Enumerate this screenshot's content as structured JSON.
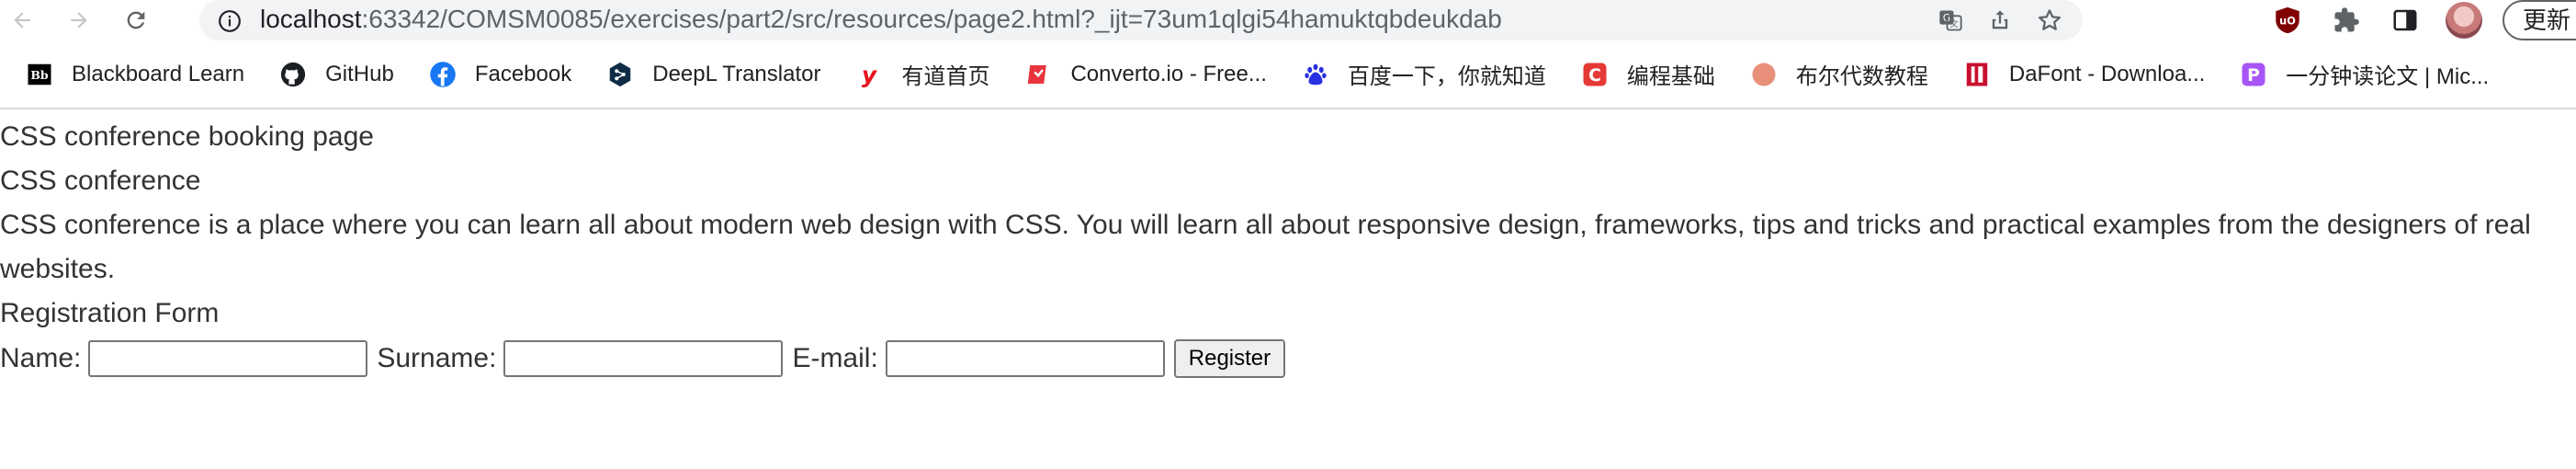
{
  "browser": {
    "url_host": "localhost",
    "url_rest": ":63342/COMSM0085/exercises/part2/src/resources/page2.html?_ijt=73um1qlgi54hamuktqbdeukdab",
    "update_label": "更新",
    "bookmarks": [
      {
        "label": "Blackboard Learn",
        "icon": "blackboard-icon",
        "color": "#000000"
      },
      {
        "label": "GitHub",
        "icon": "github-icon",
        "color": "#1b1f23"
      },
      {
        "label": "Facebook",
        "icon": "facebook-icon",
        "color": "#1877f2"
      },
      {
        "label": "DeepL Translator",
        "icon": "deepl-icon",
        "color": "#0f2b46"
      },
      {
        "label": "有道首页",
        "icon": "youdao-icon",
        "color": "#e8131e"
      },
      {
        "label": "Converto.io - Free...",
        "icon": "converto-icon",
        "color": "#e8343c"
      },
      {
        "label": "百度一下，你就知道",
        "icon": "baidu-icon",
        "color": "#2932e1"
      },
      {
        "label": "编程基础",
        "icon": "c-icon",
        "color": "#e53935"
      },
      {
        "label": "布尔代数教程",
        "icon": "circle-icon",
        "color": "#e8907a"
      },
      {
        "label": "DaFont - Downloa...",
        "icon": "dafont-icon",
        "color": "#c8102e"
      },
      {
        "label": "一分钟读论文 | Mic...",
        "icon": "p-icon",
        "color": "#a855f7"
      }
    ]
  },
  "page": {
    "title": "CSS conference booking page",
    "heading": "CSS conference",
    "description": "CSS conference is a place where you can learn all about modern web design with CSS. You will learn all about responsive design, frameworks, tips and tricks and practical examples from the designers of real websites.",
    "form_title": "Registration Form",
    "name_label": "Name:",
    "surname_label": "Surname:",
    "email_label": "E-mail:",
    "name_value": "",
    "surname_value": "",
    "email_value": "",
    "register_label": "Register"
  }
}
